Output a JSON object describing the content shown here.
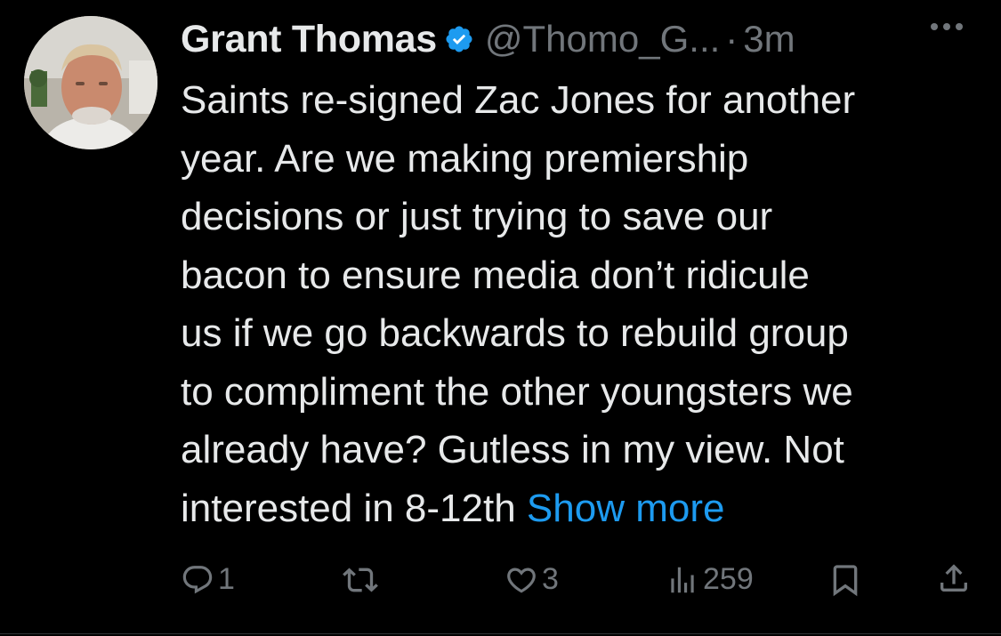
{
  "colors": {
    "background": "#000000",
    "text_primary": "#e7e9ea",
    "text_secondary": "#71767b",
    "accent": "#1d9bf0"
  },
  "tweet": {
    "author": {
      "display_name": "Grant Thomas",
      "verified_icon": "verified-badge-icon",
      "handle": "@Thomo_G...",
      "separator": "·",
      "time": "3m"
    },
    "more_icon": "more-horizontal-icon",
    "text_lines": [
      "Saints re-signed Zac Jones for another",
      "year. Are we making premiership",
      "decisions or just trying to save our",
      "bacon to ensure media don’t ridicule",
      "us if we go backwards to rebuild group",
      "to compliment the other youngsters we",
      "already have? Gutless in my view. Not",
      "interested in 8-12th"
    ],
    "show_more": "Show more",
    "actions": {
      "reply": {
        "icon": "reply-icon",
        "count": "1"
      },
      "retweet": {
        "icon": "retweet-icon",
        "count": ""
      },
      "like": {
        "icon": "heart-icon",
        "count": "3"
      },
      "views": {
        "icon": "views-icon",
        "count": "259"
      },
      "bookmark": {
        "icon": "bookmark-icon"
      },
      "share": {
        "icon": "share-icon"
      }
    }
  }
}
